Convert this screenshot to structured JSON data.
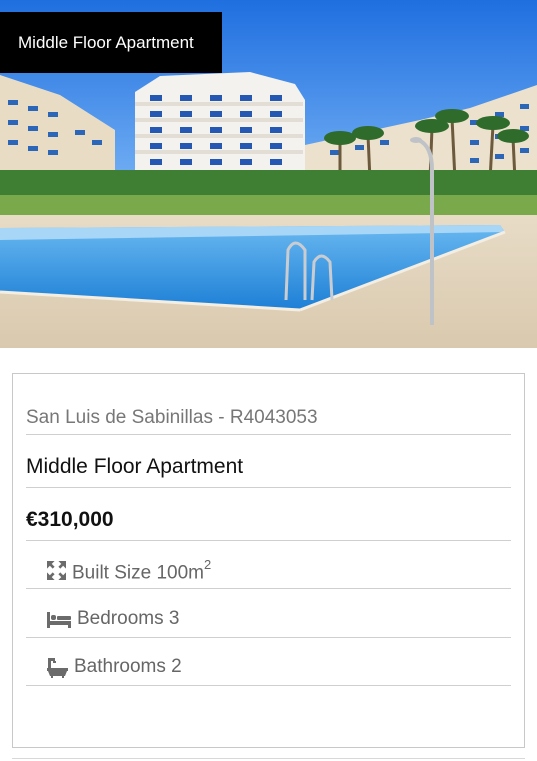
{
  "listing": {
    "type_badge": "Middle Floor Apartment",
    "location_ref": "San Luis de Sabinillas - R4043053",
    "title": "Middle Floor Apartment",
    "price": "€310,000",
    "features": {
      "built_size_label": "Built Size 100m",
      "built_size_sup": "2",
      "built_size_icon": "expand-arrows-icon",
      "bedrooms_label": "Bedrooms 3",
      "bedrooms_icon": "bed-icon",
      "bathrooms_label": "Bathrooms 2",
      "bathrooms_icon": "bathtub-icon"
    }
  },
  "colors": {
    "badge_bg": "#000000",
    "text_muted": "#777777",
    "icon_grey": "#6b6b6b",
    "divider": "#cfcfcf"
  }
}
